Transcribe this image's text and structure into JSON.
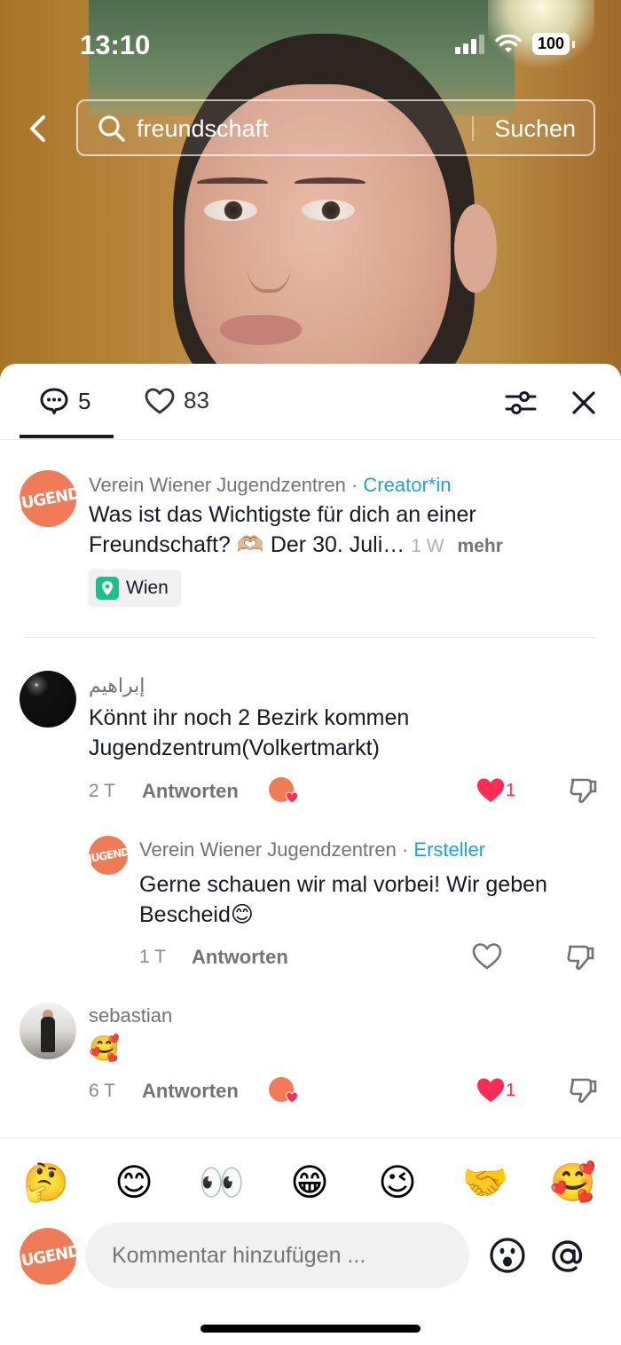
{
  "status": {
    "time": "13:10",
    "battery": "100"
  },
  "search": {
    "query": "freundschaft",
    "button": "Suchen"
  },
  "tabs": {
    "comments_count": "5",
    "likes_count": "83"
  },
  "post": {
    "author": "Verein Wiener Jugendzentren",
    "separator": " · ",
    "role": "Creator*in",
    "text_line1": "Was ist das Wichtigste für dich an einer",
    "text_line2": "Freundschaft? 🫶🏼 Der 30. Juli…",
    "age": "1 W",
    "more": "mehr",
    "location": "Wien",
    "avatar_text": "JUGEND"
  },
  "comments": [
    {
      "author": "إبراهيم",
      "text_line1": "Könnt ihr noch 2 Bezirk kommen",
      "text_line2": "Jugendzentrum(Volkertmarkt)",
      "age": "2 T",
      "reply": "Antworten",
      "likes": "1"
    },
    {
      "author": "Verein Wiener Jugendzentren",
      "separator": " · ",
      "role": "Ersteller",
      "text_line1": "Gerne schauen wir mal vorbei! Wir geben",
      "text_line2": "Bescheid😊",
      "age": "1 T",
      "reply": "Antworten"
    },
    {
      "author": "sebastian",
      "text": "🥰",
      "age": "6 T",
      "reply": "Antworten",
      "likes": "1"
    }
  ],
  "emojis": [
    "🤔",
    "😊",
    "👀",
    "😁",
    "😉",
    "🤝",
    "🥰"
  ],
  "input": {
    "placeholder": "Kommentar hinzufügen ..."
  },
  "colors": {
    "accent_like": "#fe2c55",
    "creator_tag": "#23a3c7",
    "brand_avatar": "#ef7b57"
  }
}
